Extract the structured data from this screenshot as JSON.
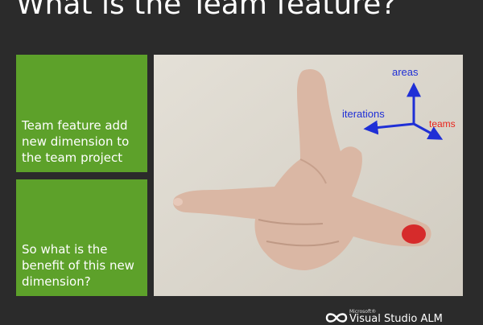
{
  "slide": {
    "title": "What is the Team feature?",
    "card_1": "Team feature add new dimension to the team project",
    "card_2": "So what is the benefit of this new dimension?"
  },
  "diagram": {
    "axis_up": "areas",
    "axis_left": "iterations",
    "axis_right": "teams"
  },
  "footer": {
    "brand_small": "Microsoft®",
    "brand_name": "Visual Studio ALM"
  },
  "colors": {
    "background": "#2b2b2b",
    "card_green": "#5da12a",
    "axis_blue": "#1f2fd6",
    "axis_red": "#e8241c"
  }
}
